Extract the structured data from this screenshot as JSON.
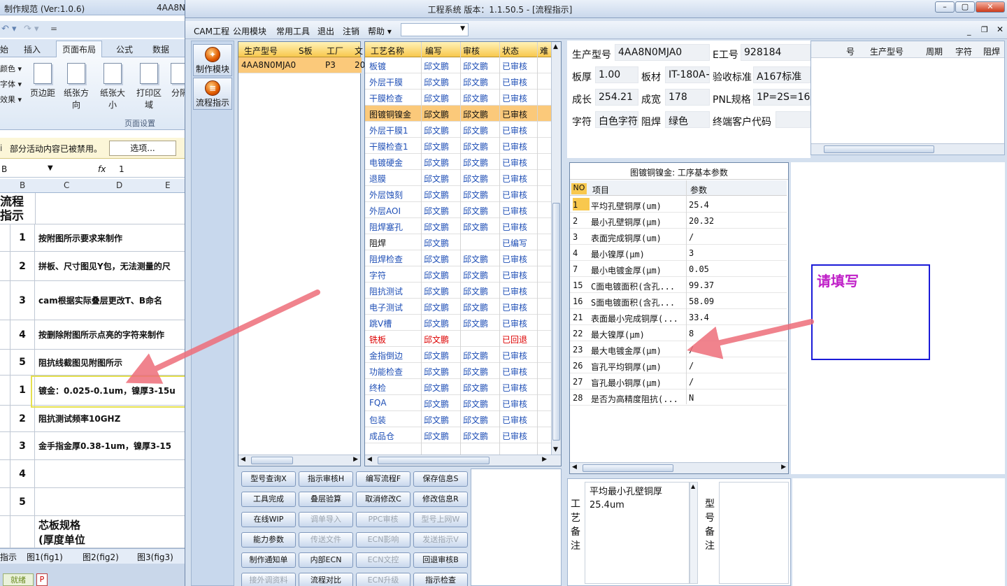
{
  "excel": {
    "title": "制作规范 (Ver:1.0.6)",
    "title_right": "4AA8N",
    "ribbon_tabs": [
      "始",
      "插入",
      "页面布局",
      "公式",
      "数据"
    ],
    "left_items": [
      "颜色 ▾",
      "字体 ▾",
      "效果 ▾"
    ],
    "ribbon_buttons": [
      "页边距",
      "纸张方向",
      "纸张大小",
      "打印区域",
      "分隔"
    ],
    "group_label": "页面设置",
    "security_text": "部分活动内容已被禁用。",
    "security_button": "选项...",
    "name_box": "B",
    "fx": "fx",
    "formula_value": "1",
    "col_headers": [
      "B",
      "C",
      "D",
      "E"
    ],
    "header_cell": "流程\n指示",
    "rows": [
      {
        "num": "1",
        "text": "按附图所示要求来制作"
      },
      {
        "num": "2",
        "text": "拼板、尺寸图见Y包，无法测量的尺"
      },
      {
        "num": "3",
        "text": "cam根据实际叠层更改T、B命名"
      },
      {
        "num": "4",
        "text": "按删除附图所示点亮的字符来制作"
      },
      {
        "num": "5",
        "text": "阻抗线截图见附图所示"
      },
      {
        "num": "1",
        "text": "镀金：0.025-0.1um，镍厚3-15u"
      },
      {
        "num": "2",
        "text": "阻抗测试频率10GHZ"
      },
      {
        "num": "3",
        "text": "金手指金厚0.38-1um，镍厚3-15"
      },
      {
        "num": "4",
        "text": ""
      },
      {
        "num": "5",
        "text": ""
      },
      {
        "num": "",
        "text": "芯板规格\n(厚度单位"
      }
    ],
    "sheet_tabs": [
      "指示",
      "图1(fig1)",
      "图2(fig2)",
      "图3(fig3)"
    ],
    "status_text": "就绪"
  },
  "app": {
    "title": "工程系统   版本：1.1.50.5 - [流程指示]",
    "menu": [
      "CAM工程",
      "公用模块",
      "常用工具",
      "退出",
      "注销",
      "帮助 ▾"
    ],
    "nav": [
      {
        "label": "制作模块",
        "icon": "make-module-icon"
      },
      {
        "label": "流程指示",
        "icon": "flow-indicate-icon"
      }
    ],
    "model_grid": {
      "headers": [
        "生产型号",
        "S板",
        "工厂",
        "文"
      ],
      "rows": [
        [
          "4AA8N0MJA0",
          "",
          "P3",
          "20"
        ]
      ]
    },
    "process_grid": {
      "headers": [
        "工艺名称",
        "编写",
        "审核",
        "状态",
        "难"
      ],
      "rows": [
        {
          "name": "板镀",
          "writer": "邱文鹏",
          "reviewer": "邱文鹏",
          "status": "已审核",
          "style": "blue"
        },
        {
          "name": "外层干膜",
          "writer": "邱文鹏",
          "reviewer": "邱文鹏",
          "status": "已审核",
          "style": "blue"
        },
        {
          "name": "干膜检查",
          "writer": "邱文鹏",
          "reviewer": "邱文鹏",
          "status": "已审核",
          "style": "blue"
        },
        {
          "name": "图镀铜镍金",
          "writer": "邱文鹏",
          "reviewer": "邱文鹏",
          "status": "已审核",
          "style": "sel"
        },
        {
          "name": "外层干膜1",
          "writer": "邱文鹏",
          "reviewer": "邱文鹏",
          "status": "已审核",
          "style": "blue"
        },
        {
          "name": "干膜检查1",
          "writer": "邱文鹏",
          "reviewer": "邱文鹏",
          "status": "已审核",
          "style": "blue"
        },
        {
          "name": "电镀硬金",
          "writer": "邱文鹏",
          "reviewer": "邱文鹏",
          "status": "已审核",
          "style": "blue"
        },
        {
          "name": "退膜",
          "writer": "邱文鹏",
          "reviewer": "邱文鹏",
          "status": "已审核",
          "style": "blue"
        },
        {
          "name": "外层蚀刻",
          "writer": "邱文鹏",
          "reviewer": "邱文鹏",
          "status": "已审核",
          "style": "blue"
        },
        {
          "name": "外层AOI",
          "writer": "邱文鹏",
          "reviewer": "邱文鹏",
          "status": "已审核",
          "style": "blue"
        },
        {
          "name": "阻焊塞孔",
          "writer": "邱文鹏",
          "reviewer": "邱文鹏",
          "status": "已审核",
          "style": "blue"
        },
        {
          "name": "阻焊",
          "writer": "邱文鹏",
          "reviewer": "",
          "status": "已编写",
          "style": "black"
        },
        {
          "name": "阻焊检查",
          "writer": "邱文鹏",
          "reviewer": "邱文鹏",
          "status": "已审核",
          "style": "blue"
        },
        {
          "name": "字符",
          "writer": "邱文鹏",
          "reviewer": "邱文鹏",
          "status": "已审核",
          "style": "blue"
        },
        {
          "name": "阻抗测试",
          "writer": "邱文鹏",
          "reviewer": "邱文鹏",
          "status": "已审核",
          "style": "blue"
        },
        {
          "name": "电子测试",
          "writer": "邱文鹏",
          "reviewer": "邱文鹏",
          "status": "已审核",
          "style": "blue"
        },
        {
          "name": "跳V槽",
          "writer": "邱文鹏",
          "reviewer": "邱文鹏",
          "status": "已审核",
          "style": "blue"
        },
        {
          "name": "铣板",
          "writer": "邱文鹏",
          "reviewer": "",
          "status": "已回退",
          "style": "red"
        },
        {
          "name": "金指倒边",
          "writer": "邱文鹏",
          "reviewer": "邱文鹏",
          "status": "已审核",
          "style": "blue"
        },
        {
          "name": "功能检查",
          "writer": "邱文鹏",
          "reviewer": "邱文鹏",
          "status": "已审核",
          "style": "blue"
        },
        {
          "name": "终检",
          "writer": "邱文鹏",
          "reviewer": "邱文鹏",
          "status": "已审核",
          "style": "blue"
        },
        {
          "name": "FQA",
          "writer": "邱文鹏",
          "reviewer": "邱文鹏",
          "status": "已审核",
          "style": "blue"
        },
        {
          "name": "包装",
          "writer": "邱文鹏",
          "reviewer": "邱文鹏",
          "status": "已审核",
          "style": "blue"
        },
        {
          "name": "成品仓",
          "writer": "邱文鹏",
          "reviewer": "邱文鹏",
          "status": "已审核",
          "style": "blue"
        }
      ]
    },
    "buttons": [
      [
        "型号查询X",
        "指示审核H",
        "编写流程F",
        "保存信息S"
      ],
      [
        "工具完成",
        "叠层验算",
        "取消修改C",
        "修改信息R"
      ],
      [
        "在线WIP",
        "调单导入",
        "PPC审核",
        "型号上网W"
      ],
      [
        "能力参数",
        "传送文件",
        "ECN影响",
        "发送指示V"
      ],
      [
        "制作通知单",
        "内部ECN",
        "ECN文控",
        "回退审核B"
      ],
      [
        "接外调资料",
        "流程对比",
        "ECN升级",
        "指示检查"
      ]
    ],
    "disabled_buttons": [
      "调单导入",
      "PPC审核",
      "型号上网W",
      "传送文件",
      "ECN影响",
      "发送指示V",
      "ECN文控",
      "接外调资料",
      "ECN升级"
    ],
    "info": {
      "model_label": "生产型号",
      "model": "4AA8N0MJA0",
      "eng_label": "E工号",
      "eng": "928184",
      "thick_label": "板厚",
      "thick": "1.00",
      "mat_label": "板材",
      "mat": "IT-180A+",
      "std_label": "验收标准",
      "std": "A167标准",
      "len_label": "成长",
      "len": "254.21",
      "wid_label": "成宽",
      "wid": "178",
      "pnl_label": "PNL规格",
      "pnl": "1P=2S=16U",
      "char_label": "字符",
      "char": "白色字符",
      "mask_label": "阻焊",
      "mask": "绿色",
      "cust_label": "终端客户代码",
      "cust": ""
    },
    "side_grid_headers": [
      "号",
      "生产型号",
      "周期",
      "字符",
      "阻焊"
    ],
    "param": {
      "title": "图镀铜镍金: 工序基本参数",
      "headers": [
        "NO",
        "项目",
        "参数"
      ],
      "rows": [
        {
          "no": "1",
          "item": "平均孔壁铜厚(um)",
          "val": "25.4"
        },
        {
          "no": "2",
          "item": "最小孔壁铜厚(μm)",
          "val": "20.32"
        },
        {
          "no": "3",
          "item": "表面完成铜厚(um)",
          "val": "/"
        },
        {
          "no": "4",
          "item": "最小镍厚(μm)",
          "val": "3"
        },
        {
          "no": "7",
          "item": "最小电镀金厚(μm)",
          "val": "0.05"
        },
        {
          "no": "15",
          "item": "C面电镀面积(含孔...",
          "val": "99.37"
        },
        {
          "no": "16",
          "item": "S面电镀面积(含孔...",
          "val": "58.09"
        },
        {
          "no": "21",
          "item": "表面最小完成铜厚(...",
          "val": "33.4"
        },
        {
          "no": "22",
          "item": "最大镍厚(μm)",
          "val": "8"
        },
        {
          "no": "23",
          "item": "最大电镀金厚(μm)",
          "val": "/"
        },
        {
          "no": "26",
          "item": "盲孔平均铜厚(μm)",
          "val": "/"
        },
        {
          "no": "27",
          "item": "盲孔最小铜厚(μm)",
          "val": "/"
        },
        {
          "no": "28",
          "item": "是否为高精度阻抗(...",
          "val": "N"
        }
      ]
    },
    "process_note_label": "工艺备注",
    "process_note": "平均最小孔壁铜厚\n25.4um",
    "model_note_label": "型号备注",
    "annotation_text": "请填写",
    "colors": {
      "header_orange": "#f8c84e",
      "selected_row": "#fbc97a",
      "text_blue": "#1f4fb6",
      "annotation_purple": "#c020c8",
      "arrow": "#ee6e7a"
    }
  }
}
